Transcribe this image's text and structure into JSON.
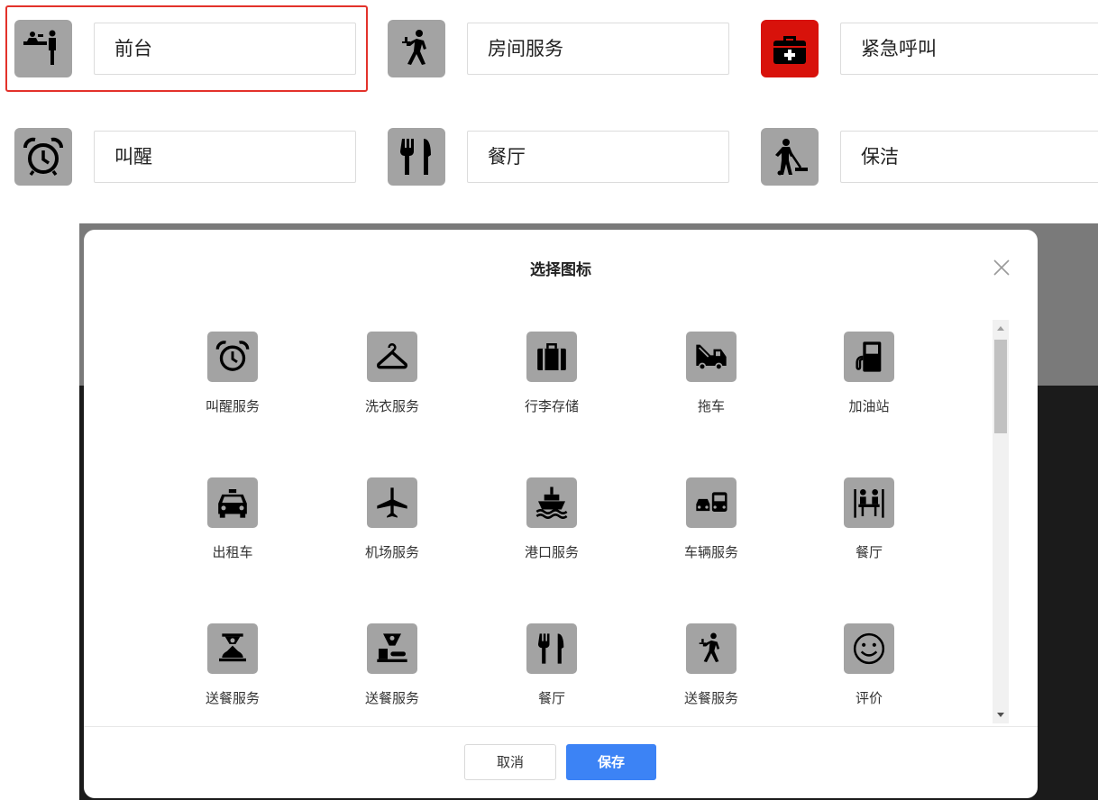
{
  "services": [
    {
      "label": "前台",
      "icon": "front-desk-icon"
    },
    {
      "label": "房间服务",
      "icon": "room-service-icon"
    },
    {
      "label": "紧急呼叫",
      "icon": "first-aid-kit-icon",
      "accent": "#d8120b"
    },
    {
      "label": "叫醒",
      "icon": "alarm-clock-icon"
    },
    {
      "label": "餐厅",
      "icon": "fork-knife-icon"
    },
    {
      "label": "保洁",
      "icon": "vacuum-cleaning-icon"
    }
  ],
  "modal": {
    "title": "选择图标",
    "icons": [
      {
        "label": "叫醒服务",
        "icon": "alarm-clock-icon"
      },
      {
        "label": "洗衣服务",
        "icon": "hanger-icon"
      },
      {
        "label": "行李存储",
        "icon": "luggage-icon"
      },
      {
        "label": "拖车",
        "icon": "tow-truck-icon"
      },
      {
        "label": "加油站",
        "icon": "gas-station-icon"
      },
      {
        "label": "出租车",
        "icon": "taxi-icon"
      },
      {
        "label": "机场服务",
        "icon": "airplane-icon"
      },
      {
        "label": "港口服务",
        "icon": "ship-icon"
      },
      {
        "label": "车辆服务",
        "icon": "car-bus-icon"
      },
      {
        "label": "餐厅",
        "icon": "dining-people-icon"
      },
      {
        "label": "送餐服务",
        "icon": "waiter-cloche-icon"
      },
      {
        "label": "送餐服务",
        "icon": "server-tray-icon"
      },
      {
        "label": "餐厅",
        "icon": "fork-knife-icon"
      },
      {
        "label": "送餐服务",
        "icon": "room-service-icon"
      },
      {
        "label": "评价",
        "icon": "smiley-icon"
      }
    ],
    "cancel_label": "取消",
    "save_label": "保存"
  },
  "colors": {
    "primary": "#3c83f5",
    "selected_border": "#e3322b",
    "icon_bg": "#a3a3a3",
    "emergency": "#d8120b"
  }
}
